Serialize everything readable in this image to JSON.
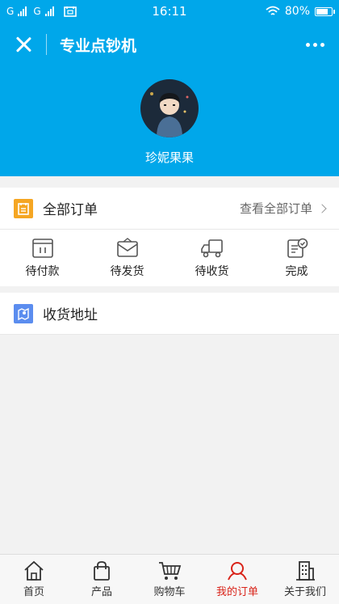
{
  "status_bar": {
    "carrier1": "G",
    "carrier2": "G",
    "time": "16:11",
    "battery": "80%",
    "battery_level": 0.8
  },
  "title_bar": {
    "title": "专业点钞机"
  },
  "profile": {
    "username": "珍妮果果"
  },
  "orders": {
    "header_label": "全部订单",
    "view_all": "查看全部订单",
    "statuses": [
      {
        "label": "待付款",
        "icon": "payment-icon"
      },
      {
        "label": "待发货",
        "icon": "envelope-icon"
      },
      {
        "label": "待收货",
        "icon": "truck-icon"
      },
      {
        "label": "完成",
        "icon": "clipboard-check-icon"
      }
    ]
  },
  "address": {
    "label": "收货地址"
  },
  "tabbar": {
    "active_color": "#d9241a",
    "tabs": [
      {
        "label": "首页",
        "icon": "home-icon"
      },
      {
        "label": "产品",
        "icon": "bag-icon"
      },
      {
        "label": "购物车",
        "icon": "cart-icon"
      },
      {
        "label": "我的订单",
        "icon": "user-icon",
        "active": true
      },
      {
        "label": "关于我们",
        "icon": "building-icon"
      }
    ]
  },
  "colors": {
    "primary": "#00a7ea",
    "order_icon": "#f5a623",
    "address_icon": "#5b8def"
  }
}
